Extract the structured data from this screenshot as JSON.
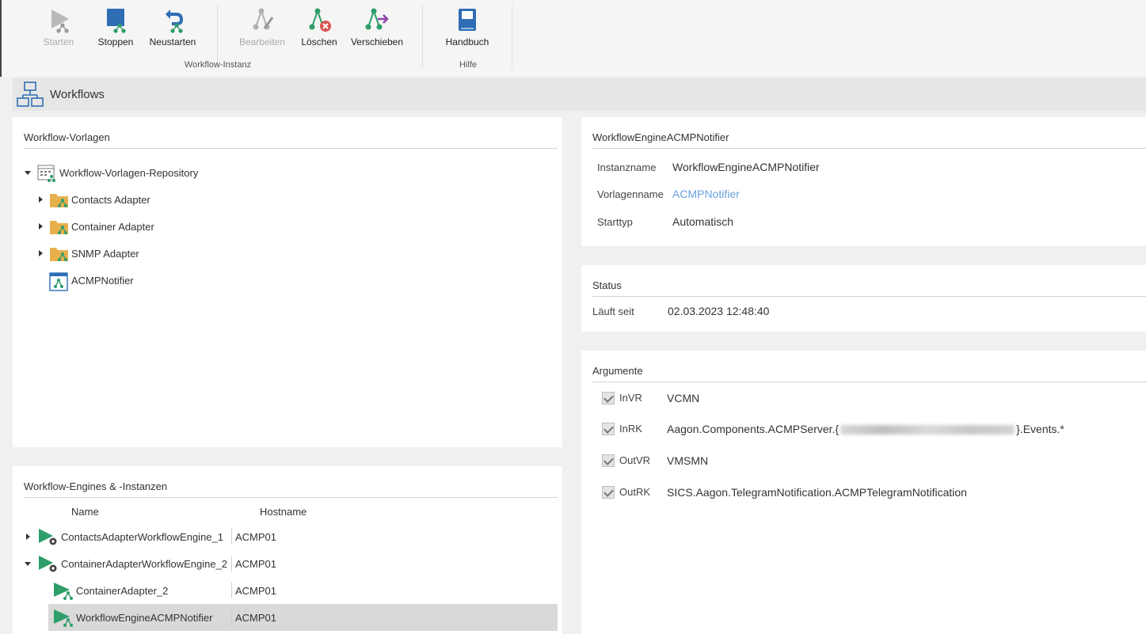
{
  "ribbon": {
    "buttons": {
      "start": "Starten",
      "stop": "Stoppen",
      "restart": "Neustarten",
      "edit": "Bearbeiten",
      "delete": "Löschen",
      "move": "Verschieben",
      "manual": "Handbuch"
    },
    "groups": {
      "instance": "Workflow-Instanz",
      "help": "Hilfe"
    }
  },
  "header": {
    "title": "Workflows"
  },
  "templates": {
    "title": "Workflow-Vorlagen",
    "root": "Workflow-Vorlagen-Repository",
    "items": [
      "Contacts Adapter",
      "Container Adapter",
      "SNMP Adapter",
      "ACMPNotifier"
    ]
  },
  "engines": {
    "title": "Workflow-Engines & -Instanzen",
    "col_name": "Name",
    "col_host": "Hostname",
    "rows": [
      {
        "name": "ContactsAdapterWorkflowEngine_1",
        "host": "ACMP01"
      },
      {
        "name": "ContainerAdapterWorkflowEngine_2",
        "host": "ACMP01"
      },
      {
        "name": "ContainerAdapter_2",
        "host": "ACMP01"
      },
      {
        "name": "WorkflowEngineACMPNotifier",
        "host": "ACMP01"
      }
    ]
  },
  "details": {
    "title": "WorkflowEngineACMPNotifier",
    "instance_label": "Instanzname",
    "instance_value": "WorkflowEngineACMPNotifier",
    "template_label": "Vorlagenname",
    "template_value": "ACMPNotifier",
    "start_label": "Starttyp",
    "start_value": "Automatisch"
  },
  "status": {
    "title": "Status",
    "running_label": "Läuft seit",
    "running_value": "02.03.2023 12:48:40"
  },
  "arguments": {
    "title": "Argumente",
    "items": [
      {
        "label": "InVR",
        "value": "VCMN"
      },
      {
        "label": "InRK",
        "value_prefix": "Aagon.Components.ACMPServer.{",
        "value_suffix": "}.Events.*"
      },
      {
        "label": "OutVR",
        "value": "VMSMN"
      },
      {
        "label": "OutRK",
        "value": "SICS.Aagon.TelegramNotification.ACMPTelegramNotification"
      }
    ]
  },
  "colors": {
    "accent": "#2f6db5",
    "green": "#2e9e6a",
    "link": "#6aa0e0",
    "folder": "#e8b04c"
  }
}
